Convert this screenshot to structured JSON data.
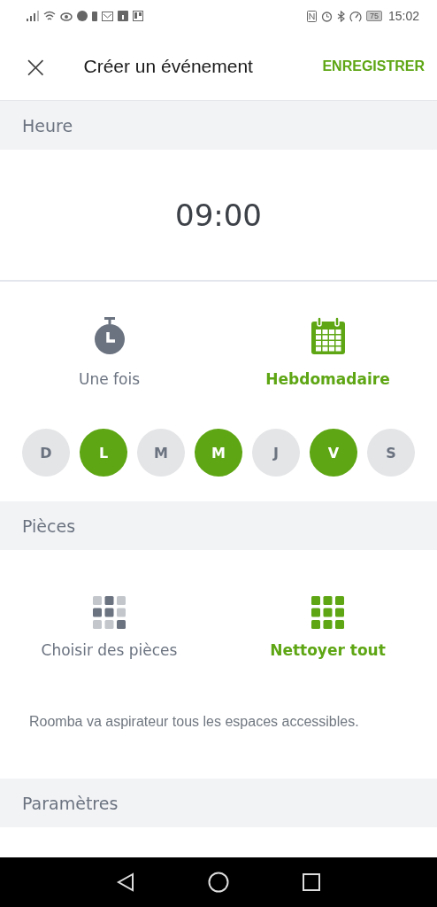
{
  "status_bar": {
    "battery": "75",
    "time": "15:02"
  },
  "header": {
    "close": "×",
    "title": "Créer un événement",
    "save": "ENREGISTRER"
  },
  "time_section": {
    "heading": "Heure",
    "time": "09:00"
  },
  "frequency": [
    {
      "kind": "timer",
      "label": "Une fois",
      "selected": false
    },
    {
      "kind": "calendar",
      "label": "Hebdomadaire",
      "selected": true
    }
  ],
  "days": [
    {
      "label": "D",
      "selected": false
    },
    {
      "label": "L",
      "selected": true
    },
    {
      "label": "M",
      "selected": false
    },
    {
      "label": "M",
      "selected": true
    },
    {
      "label": "J",
      "selected": false
    },
    {
      "label": "V",
      "selected": true
    },
    {
      "label": "S",
      "selected": false
    }
  ],
  "rooms_section": {
    "heading": "Pièces",
    "options": [
      {
        "kind": "choose",
        "label": "Choisir des pièces",
        "selected": false
      },
      {
        "kind": "all",
        "label": "Nettoyer tout",
        "selected": true
      }
    ],
    "description": "Roomba va aspirateur tous les espaces accessibles."
  },
  "settings_section": {
    "heading": "Paramètres"
  }
}
